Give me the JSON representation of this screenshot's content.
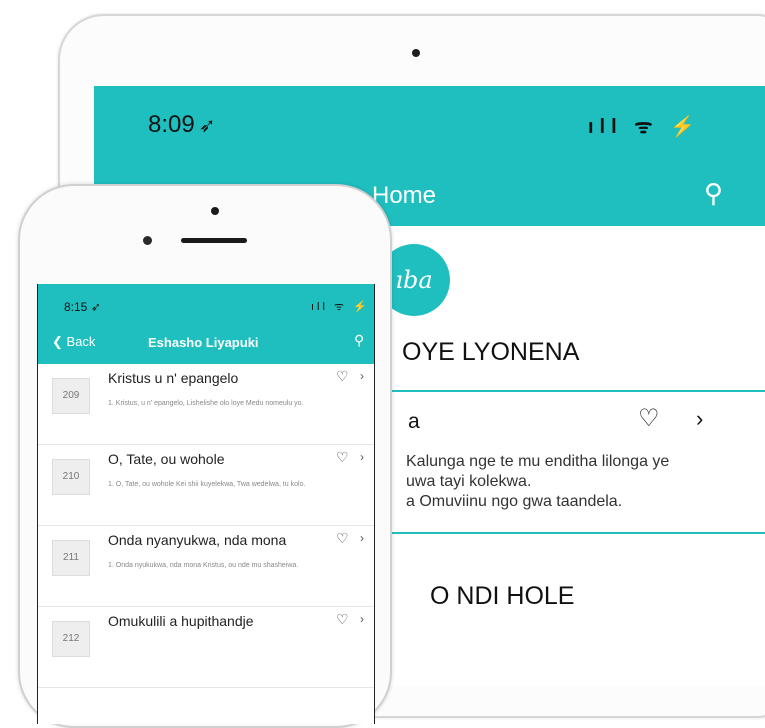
{
  "ipad": {
    "time": "8:09",
    "location_icon": "location-arrow-icon",
    "status": "ıll ᯤ ⚡",
    "nav_title": "Home",
    "logo_text": "ıba",
    "section1_heading": "OYE LYONENA",
    "card": {
      "title": "a",
      "body": "Kalunga nge te mu enditha lilonga ye\nuwa tayi kolekwa.\na Omuviinu ngo gwa taandela."
    },
    "section2_heading": "O NDI HOLE"
  },
  "phone": {
    "time": "8:15",
    "status": "ıll ᯤ ⚡",
    "back_label": "Back",
    "nav_title": "Eshasho Liyapuki",
    "songs": [
      {
        "number": "209",
        "title": "Kristus u n' epangelo",
        "excerpt": "1. Kristus, u n' epangelo, Lishelishe olo loye Medu nomeulu yo."
      },
      {
        "number": "210",
        "title": "O, Tate, ou wohole",
        "excerpt": "1. O, Tate, ou wohole Kei shii kuyelekwa, Twa wedelwa, tu kolo."
      },
      {
        "number": "211",
        "title": "Onda nyanyukwa, nda mona",
        "excerpt": "1. Onda nyukukwa, nda mona Kristus, ou nde mu shasheiwa."
      },
      {
        "number": "212",
        "title": "Omukulili a hupithandje",
        "excerpt": ""
      }
    ]
  },
  "colors": {
    "accent": "#1fbfbf"
  }
}
